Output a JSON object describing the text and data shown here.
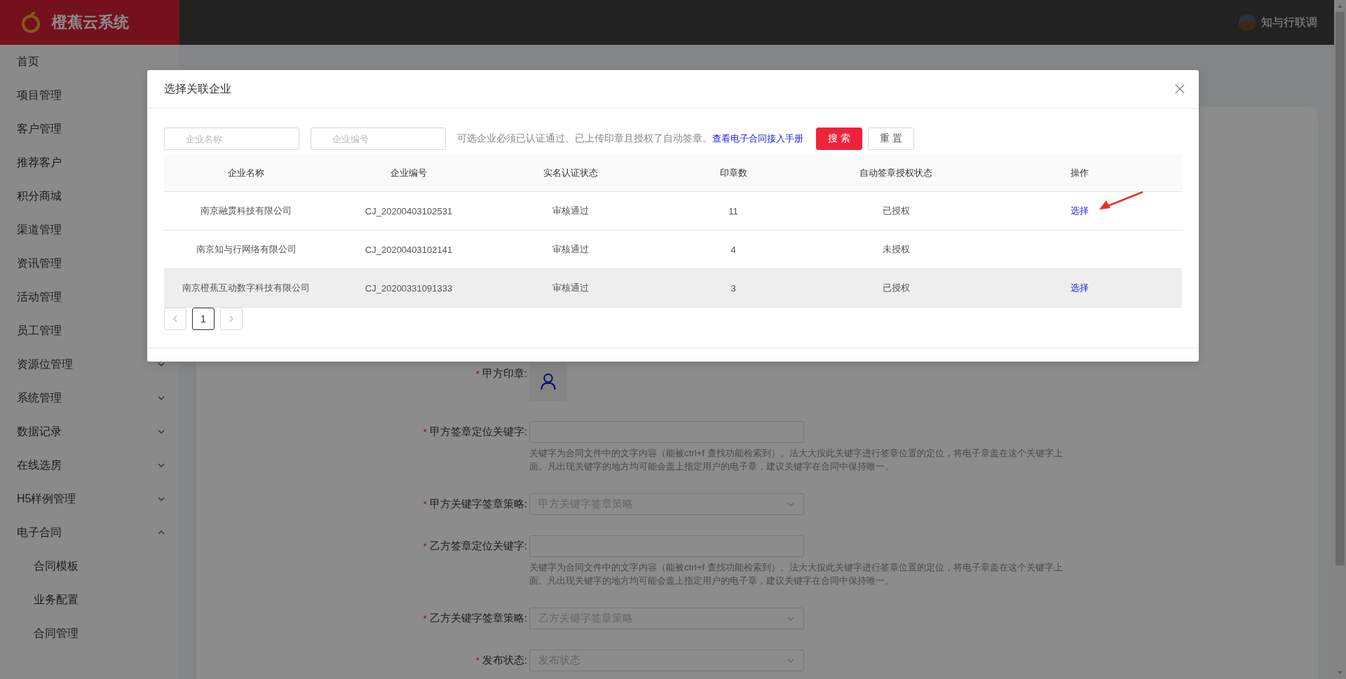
{
  "header": {
    "logo_text": "橙蕉云系统",
    "user_name": "知与行联调"
  },
  "sidebar": {
    "items": [
      {
        "label": "首页",
        "kind": "link"
      },
      {
        "label": "项目管理",
        "kind": "link"
      },
      {
        "label": "客户管理",
        "kind": "link"
      },
      {
        "label": "推荐客户",
        "kind": "link"
      },
      {
        "label": "积分商城",
        "kind": "link"
      },
      {
        "label": "渠道管理",
        "kind": "link"
      },
      {
        "label": "资讯管理",
        "kind": "link"
      },
      {
        "label": "活动管理",
        "kind": "link"
      },
      {
        "label": "员工管理",
        "kind": "link"
      },
      {
        "label": "资源位管理",
        "kind": "group",
        "expanded": false
      },
      {
        "label": "系统管理",
        "kind": "group",
        "expanded": false
      },
      {
        "label": "数据记录",
        "kind": "group",
        "expanded": false
      },
      {
        "label": "在线选房",
        "kind": "group",
        "expanded": false
      },
      {
        "label": "H5样例管理",
        "kind": "group",
        "expanded": false
      },
      {
        "label": "电子合同",
        "kind": "group",
        "expanded": true,
        "children": [
          {
            "label": "合同模板"
          },
          {
            "label": "业务配置"
          },
          {
            "label": "合同管理"
          }
        ]
      }
    ]
  },
  "form": {
    "fields": [
      {
        "kind": "upload",
        "label": "甲方印章:",
        "required_mark": "*"
      },
      {
        "kind": "input",
        "label": "甲方签章定位关键字:",
        "required_mark": "*",
        "help": "关键字为合同文件中的文字内容（能被ctrl+f 查找功能检索到）。法大大按此关键字进行签章位置的定位，将电子章盖在这个关键字上面。凡出现关键字的地方均可能会盖上指定用户的电子章，建议关键字在合同中保持唯一。"
      },
      {
        "kind": "select",
        "label": "甲方关键字签章策略:",
        "required_mark": "*",
        "placeholder": "甲方关键字签章策略"
      },
      {
        "kind": "input",
        "label": "乙方签章定位关键字:",
        "required_mark": "*",
        "help": "关键字为合同文件中的文字内容（能被ctrl+f 查找功能检索到）。法大大按此关键字进行签章位置的定位，将电子章盖在这个关键字上面。凡出现关键字的地方均可能会盖上指定用户的电子章，建议关键字在合同中保持唯一。"
      },
      {
        "kind": "select",
        "label": "乙方关键字签章策略:",
        "required_mark": "*",
        "placeholder": "乙方关键字签章策略"
      },
      {
        "kind": "select",
        "label": "发布状态:",
        "required_mark": "*",
        "placeholder": "发布状态"
      }
    ]
  },
  "modal": {
    "title": "选择关联企业",
    "filters": [
      {
        "placeholder": "企业名称"
      },
      {
        "placeholder": "企业编号"
      }
    ],
    "hint": "可选企业必须已认证通过、已上传印章且授权了自动签章。",
    "hint_link": "查看电子合同接入手册",
    "buttons": [
      {
        "label": "搜 索",
        "kind": "primary"
      },
      {
        "label": "重 置",
        "kind": "default"
      }
    ],
    "table": {
      "columns": [
        "企业名称",
        "企业编号",
        "实名认证状态",
        "印章数",
        "自动签章授权状态",
        "操作"
      ],
      "rows": [
        {
          "cells": [
            "南京融贯科技有限公司",
            "CJ_20200403102531",
            "审核通过",
            "11",
            "已授权"
          ],
          "action": "选择",
          "hovered": false
        },
        {
          "cells": [
            "南京知与行网络有限公司",
            "CJ_20200403102141",
            "审核通过",
            "4",
            "未授权"
          ],
          "hovered": false
        },
        {
          "cells": [
            "南京橙蕉互动数字科技有限公司",
            "CJ_20200331091333",
            "审核通过",
            "3",
            "已授权"
          ],
          "action": "选择",
          "hovered": true
        }
      ]
    },
    "pagination": {
      "pages": [
        {
          "label": "1",
          "selected": true
        }
      ]
    }
  }
}
